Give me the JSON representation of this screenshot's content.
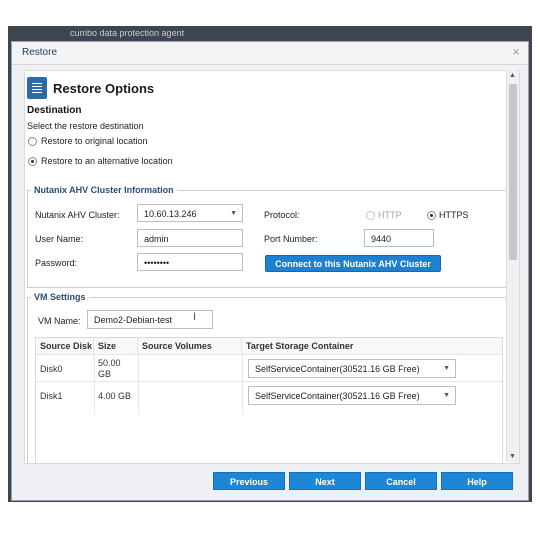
{
  "background": {
    "strip_text": "cumbo data protection agent"
  },
  "dialog": {
    "title": "Restore",
    "close_symbol": "×"
  },
  "header": {
    "title": "Restore Options",
    "icon": "document-icon"
  },
  "destination": {
    "title": "Destination",
    "instruction": "Select the restore destination",
    "options": [
      {
        "label": "Restore to original location",
        "selected": false
      },
      {
        "label": "Restore to an alternative location",
        "selected": true
      }
    ]
  },
  "cluster": {
    "legend": "Nutanix AHV Cluster Information",
    "cluster_label": "Nutanix AHV Cluster:",
    "cluster_value": "10.60.13.246",
    "username_label": "User Name:",
    "username_value": "admin",
    "password_label": "Password:",
    "password_value": "••••••••",
    "protocol_label": "Protocol:",
    "protocol_http": "HTTP",
    "protocol_https": "HTTPS",
    "protocol_selected": "HTTPS",
    "port_label": "Port Number:",
    "port_value": "9440",
    "connect_button": "Connect to this Nutanix AHV Cluster"
  },
  "vm": {
    "legend": "VM Settings",
    "name_label": "VM Name:",
    "name_value": "Demo2-Debian-test",
    "columns": [
      "Source Disk",
      "Size",
      "Source Volumes",
      "Target Storage Container"
    ],
    "rows": [
      {
        "disk": "Disk0",
        "size_line1": "50.00",
        "size_line2": "GB",
        "volumes": "",
        "target": "SelfServiceContainer(30521.16 GB Free)"
      },
      {
        "disk": "Disk1",
        "size_line1": "4.00 GB",
        "size_line2": "",
        "volumes": "",
        "target": "SelfServiceContainer(30521.16 GB Free)"
      }
    ]
  },
  "footer": {
    "previous": "Previous",
    "next": "Next",
    "cancel": "Cancel",
    "help": "Help"
  },
  "colors": {
    "accent": "#1e86d6",
    "legend": "#2a4d78",
    "background_app": "#3d4650"
  }
}
